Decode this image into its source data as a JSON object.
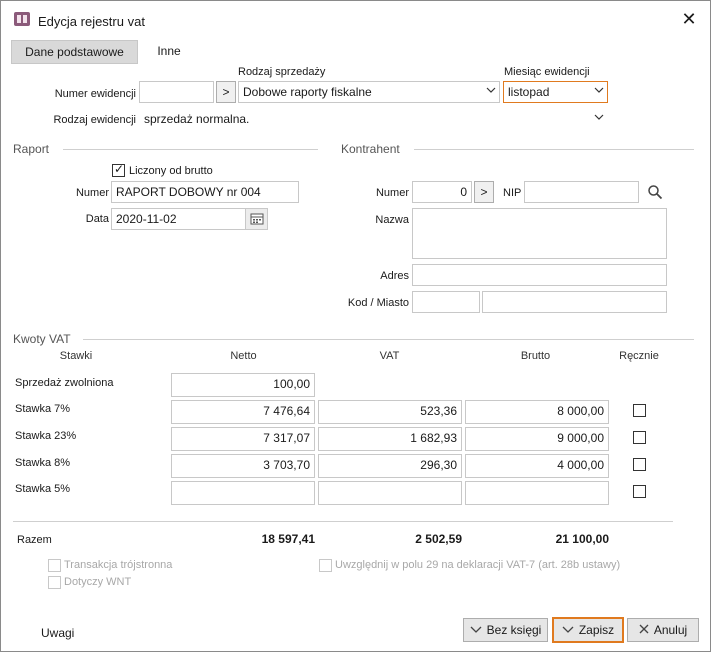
{
  "window": {
    "title": "Edycja rejestru vat"
  },
  "tabs": [
    {
      "label": "Dane podstawowe"
    },
    {
      "label": "Inne"
    }
  ],
  "header": {
    "numer_ewidencji_label": "Numer ewidencji",
    "numer_ewidencji_value": "",
    "rodzaj_sprzedazy_label": "Rodzaj sprzedaży",
    "rodzaj_sprzedazy_value": "Dobowe raporty fiskalne",
    "miesiac_label": "Miesiąc ewidencji",
    "miesiac_value": "listopad",
    "rodzaj_ewidencji_label": "Rodzaj ewidencji",
    "rodzaj_ewidencji_value": "sprzedaż normalna.",
    "arrow_glyph": ">"
  },
  "raport": {
    "section_label": "Raport",
    "liczony_label": "Liczony od brutto",
    "liczony_checked": true,
    "numer_label": "Numer",
    "numer_value": "RAPORT DOBOWY nr 004",
    "data_label": "Data",
    "data_value": "2020-11-02"
  },
  "kontrahent": {
    "section_label": "Kontrahent",
    "numer_label": "Numer",
    "numer_value": "0",
    "nip_label": "NIP",
    "nip_value": "",
    "nazwa_label": "Nazwa",
    "nazwa_value": "",
    "adres_label": "Adres",
    "adres_value": "",
    "kod_miasto_label": "Kod / Miasto",
    "kod_value": "",
    "miasto_value": ""
  },
  "kwoty": {
    "section_label": "Kwoty VAT",
    "headers": {
      "stawki": "Stawki",
      "netto": "Netto",
      "vat": "VAT",
      "brutto": "Brutto",
      "recznie": "Ręcznie"
    },
    "rows": [
      {
        "label": "Sprzedaż zwolniona",
        "netto": "100,00",
        "vat": "",
        "brutto": ""
      },
      {
        "label": "Stawka 7%",
        "netto": "7 476,64",
        "vat": "523,36",
        "brutto": "8 000,00"
      },
      {
        "label": "Stawka 23%",
        "netto": "7 317,07",
        "vat": "1 682,93",
        "brutto": "9 000,00"
      },
      {
        "label": "Stawka 8%",
        "netto": "3 703,70",
        "vat": "296,30",
        "brutto": "4 000,00"
      },
      {
        "label": "Stawka 5%",
        "netto": "",
        "vat": "",
        "brutto": ""
      }
    ],
    "razem_label": "Razem",
    "razem_netto": "18 597,41",
    "razem_vat": "2 502,59",
    "razem_brutto": "21 100,00"
  },
  "options": {
    "transakcja_label": "Transakcja trójstronna",
    "dotyczy_label": "Dotyczy WNT",
    "uwzglednij_label": "Uwzględnij w polu 29 na deklaracji VAT-7 (art. 28b ustawy)"
  },
  "footer": {
    "uwagi_label": "Uwagi",
    "bez_ksiegi_label": "Bez księgi",
    "zapisz_label": "Zapisz",
    "anuluj_label": "Anuluj"
  },
  "colors": {
    "accent": "#e07a1f",
    "tab_active": "#d9d9d9",
    "icon": "#8b5a7a"
  }
}
